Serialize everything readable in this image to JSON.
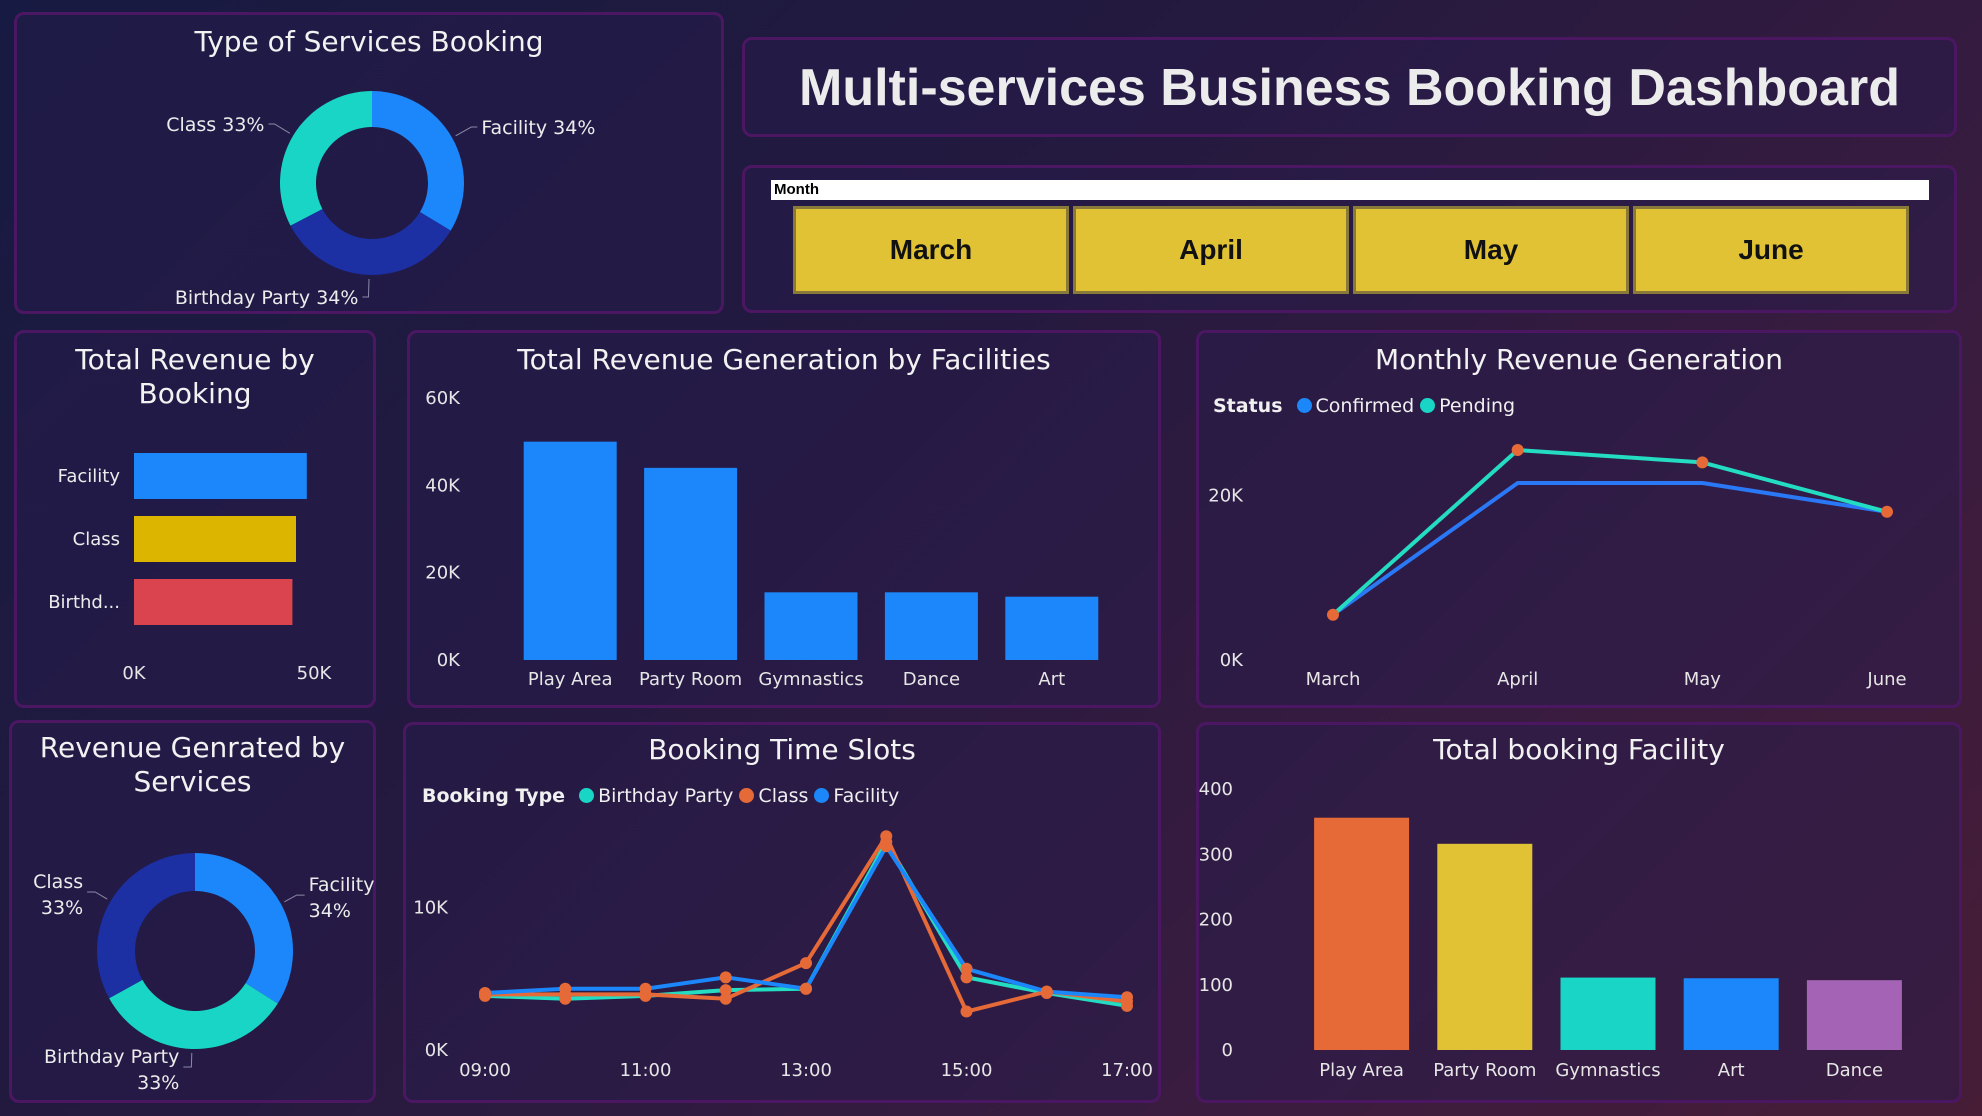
{
  "header": {
    "title": "Multi-services Business Booking Dashboard"
  },
  "slicer": {
    "label": "Month",
    "months": [
      "March",
      "April",
      "May",
      "June"
    ]
  },
  "colors": {
    "blue": "#1b87fb",
    "darkblue": "#1c2fa3",
    "teal": "#19d5c6",
    "orange": "#e56a38",
    "yellow": "#dcb500",
    "red": "#d9444f",
    "gold": "#e1c234",
    "purple": "#a563b5",
    "line_blue": "#2a78f5",
    "line_teal": "#23dcc2",
    "marker": "#e56a38"
  },
  "panels": {
    "service_types": {
      "title": "Type of Services Booking",
      "chart_data": {
        "type": "pie",
        "categories": [
          "Facility",
          "Birthday Party",
          "Class"
        ],
        "values": [
          34,
          34,
          33
        ],
        "labels": [
          "Facility 34%",
          "Birthday Party 34%",
          "Class 33%"
        ]
      }
    },
    "revenue_by_booking": {
      "title_lines": [
        "Total Revenue by",
        "Booking"
      ],
      "chart_data": {
        "type": "bar",
        "orientation": "horizontal",
        "categories": [
          "Facility",
          "Class",
          "Birthd..."
        ],
        "values": [
          48000,
          45000,
          44000
        ],
        "x_ticks": [
          "0K",
          "50K"
        ],
        "xlim": [
          0,
          50000
        ]
      }
    },
    "revenue_facilities": {
      "title": "Total Revenue Generation by Facilities",
      "chart_data": {
        "type": "bar",
        "categories": [
          "Play Area",
          "Party Room",
          "Gymnastics",
          "Dance",
          "Art"
        ],
        "values": [
          50000,
          44000,
          15500,
          15500,
          14500
        ],
        "y_ticks": [
          "0K",
          "20K",
          "40K",
          "60K"
        ],
        "ylim": [
          0,
          60000
        ]
      }
    },
    "monthly_revenue": {
      "title": "Monthly Revenue Generation",
      "legend_title": "Status",
      "chart_data": {
        "type": "line",
        "x": [
          "March",
          "April",
          "May",
          "June"
        ],
        "series": [
          {
            "name": "Confirmed",
            "values": [
              5500,
              21500,
              21500,
              18000
            ]
          },
          {
            "name": "Pending",
            "values": [
              5500,
              25500,
              24000,
              18000
            ]
          }
        ],
        "y_ticks": [
          "0K",
          "20K"
        ],
        "ylim": [
          0,
          30000
        ]
      }
    },
    "revenue_services": {
      "title_lines": [
        "Revenue Genrated by",
        "Services"
      ],
      "chart_data": {
        "type": "pie",
        "categories": [
          "Facility",
          "Birthday Party",
          "Class"
        ],
        "values": [
          34,
          33,
          33
        ],
        "labels": [
          [
            "Facility",
            "34%"
          ],
          [
            "Birthday Party",
            "33%"
          ],
          [
            "Class",
            "33%"
          ]
        ]
      }
    },
    "time_slots": {
      "title": "Booking Time Slots",
      "legend_title": "Booking Type",
      "chart_data": {
        "type": "line",
        "x": [
          "09:00",
          "10:00",
          "11:00",
          "12:00",
          "13:00",
          "14:00",
          "15:00",
          "16:00",
          "17:00"
        ],
        "x_ticks": [
          "09:00",
          "11:00",
          "13:00",
          "15:00",
          "17:00"
        ],
        "series": [
          {
            "name": "Birthday Party",
            "values": [
              3800,
              3600,
              3800,
              4200,
              4300,
              14600,
              5100,
              4000,
              3100
            ]
          },
          {
            "name": "Class",
            "values": [
              3900,
              3900,
              3900,
              3600,
              6100,
              15000,
              2700,
              4100,
              3400
            ]
          },
          {
            "name": "Facility",
            "values": [
              4000,
              4300,
              4300,
              5100,
              4300,
              14300,
              5700,
              4100,
              3700
            ]
          }
        ],
        "y_ticks": [
          "0K",
          "10K"
        ],
        "ylim": [
          0,
          16000
        ]
      }
    },
    "booking_facility": {
      "title": "Total booking Facility",
      "chart_data": {
        "type": "bar",
        "categories": [
          "Play Area",
          "Party Room",
          "Gymnastics",
          "Art",
          "Dance"
        ],
        "values": [
          356,
          316,
          111,
          110,
          107
        ],
        "y_ticks": [
          "0",
          "100",
          "200",
          "300",
          "400"
        ],
        "ylim": [
          0,
          400
        ]
      }
    }
  }
}
